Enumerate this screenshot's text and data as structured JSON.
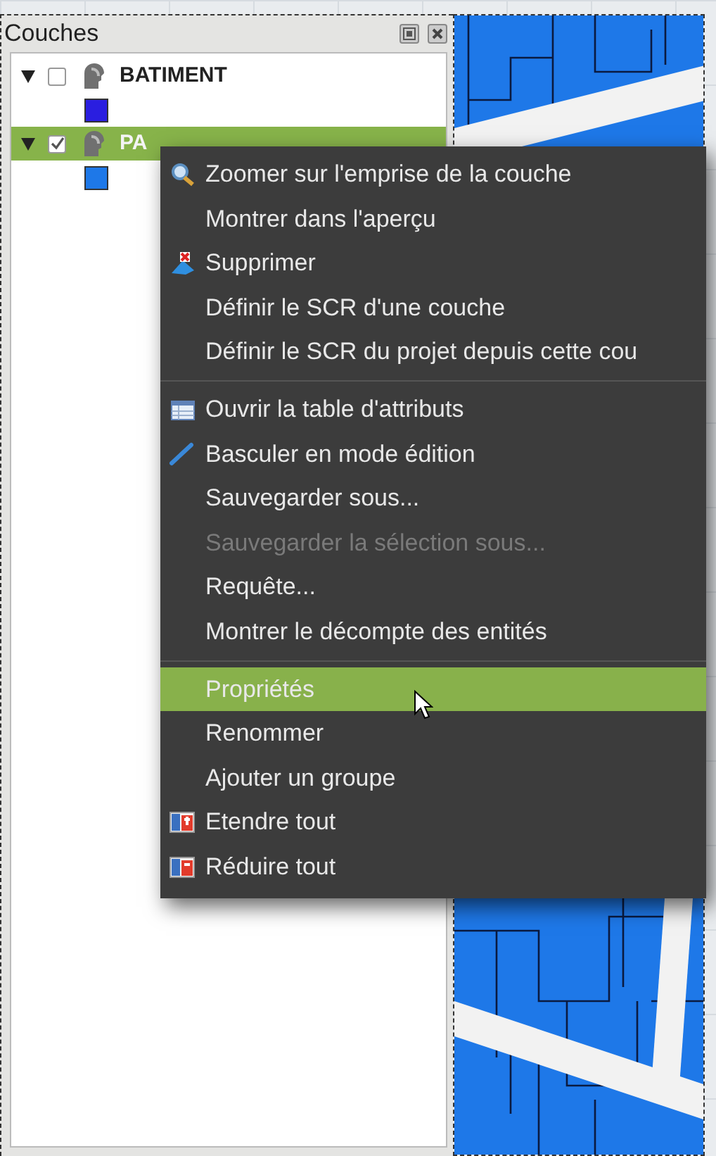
{
  "panel": {
    "title": "Couches"
  },
  "layers": [
    {
      "name": "BATIMENT",
      "expanded": true,
      "checked": false,
      "selected": false,
      "color": "#2a1ee0"
    },
    {
      "name": "PA",
      "expanded": true,
      "checked": true,
      "selected": true,
      "color": "#1e78e8"
    }
  ],
  "context_menu": {
    "items": [
      {
        "kind": "item",
        "label": "Zoomer sur l'emprise de la couche",
        "disabled": false,
        "selected": false
      },
      {
        "kind": "item",
        "label": "Montrer dans l'aperçu",
        "disabled": false,
        "selected": false
      },
      {
        "kind": "item",
        "label": "Supprimer",
        "disabled": false,
        "selected": false
      },
      {
        "kind": "item",
        "label": "Définir le SCR d'une couche",
        "disabled": false,
        "selected": false
      },
      {
        "kind": "item",
        "label": "Définir le SCR du projet depuis cette cou",
        "disabled": false,
        "selected": false
      },
      {
        "kind": "separator"
      },
      {
        "kind": "item",
        "label": "Ouvrir la table d'attributs",
        "disabled": false,
        "selected": false
      },
      {
        "kind": "item",
        "label": "Basculer en mode édition",
        "disabled": false,
        "selected": false
      },
      {
        "kind": "item",
        "label": "Sauvegarder sous...",
        "disabled": false,
        "selected": false
      },
      {
        "kind": "item",
        "label": "Sauvegarder la sélection sous...",
        "disabled": true,
        "selected": false
      },
      {
        "kind": "item",
        "label": "Requête...",
        "disabled": false,
        "selected": false
      },
      {
        "kind": "item",
        "label": "Montrer le décompte des entités",
        "disabled": false,
        "selected": false
      },
      {
        "kind": "separator"
      },
      {
        "kind": "item",
        "label": "Propriétés",
        "disabled": false,
        "selected": true
      },
      {
        "kind": "item",
        "label": "Renommer",
        "disabled": false,
        "selected": false
      },
      {
        "kind": "item",
        "label": "Ajouter un groupe",
        "disabled": false,
        "selected": false
      },
      {
        "kind": "item",
        "label": "Etendre tout",
        "disabled": false,
        "selected": false
      },
      {
        "kind": "item",
        "label": "Réduire tout",
        "disabled": false,
        "selected": false
      }
    ]
  }
}
